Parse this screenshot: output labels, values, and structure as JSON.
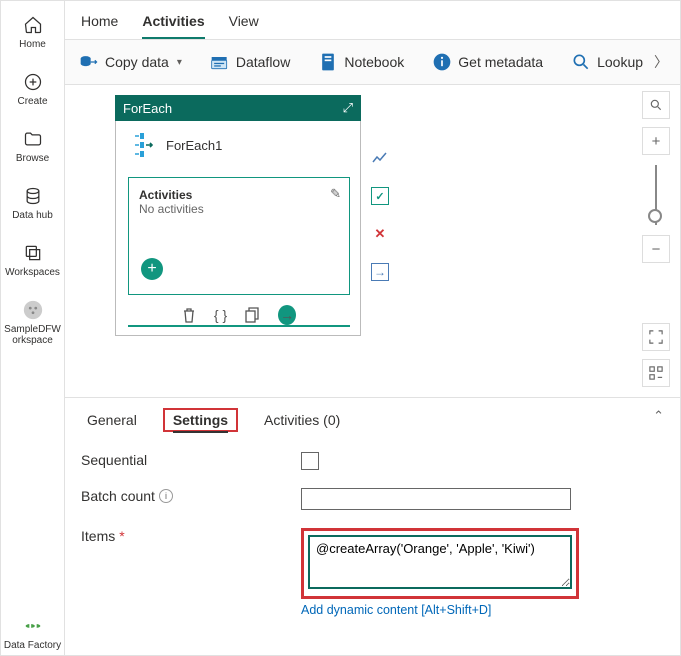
{
  "rail": {
    "home": "Home",
    "create": "Create",
    "browse": "Browse",
    "datahub": "Data hub",
    "workspaces": "Workspaces",
    "sample": "SampleDFW\norkspace",
    "datafactory": "Data Factory"
  },
  "toptabs": {
    "home": "Home",
    "activities": "Activities",
    "view": "View"
  },
  "toolbar": {
    "copydata": "Copy data",
    "dataflow": "Dataflow",
    "notebook": "Notebook",
    "getmetadata": "Get metadata",
    "lookup": "Lookup"
  },
  "foreach": {
    "header": "ForEach",
    "name": "ForEach1",
    "activities_title": "Activities",
    "activities_sub": "No activities"
  },
  "panel": {
    "tab_general": "General",
    "tab_settings": "Settings",
    "tab_activities": "Activities (0)",
    "sequential": "Sequential",
    "batch": "Batch count",
    "items": "Items",
    "items_value": "@createArray('Orange', 'Apple', 'Kiwi')",
    "dynamic": "Add dynamic content [Alt+Shift+D]"
  }
}
